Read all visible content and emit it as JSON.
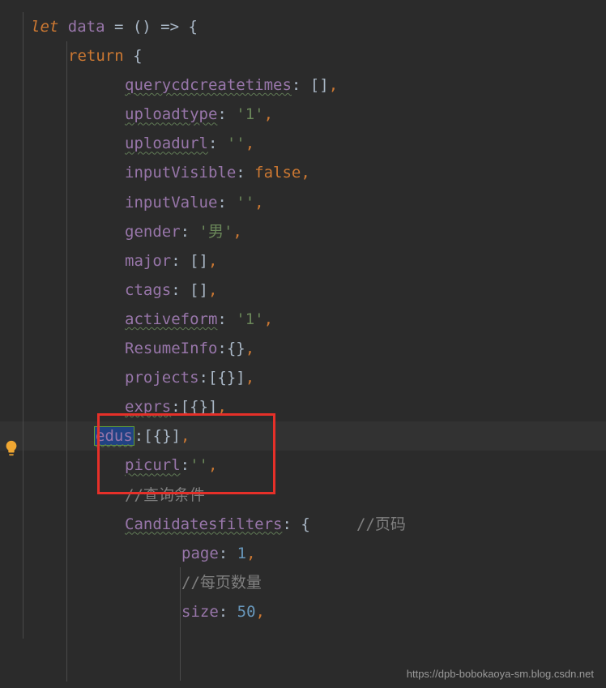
{
  "code": {
    "line1_let": "let",
    "line1_data": "data",
    "line1_rest": " = () => {",
    "line2_return": "return",
    "line2_brace": " {",
    "p_querycdcreatetimes": "querycdcreatetimes",
    "v_querycdcreatetimes": "[]",
    "p_uploadtype": "uploadtype",
    "v_uploadtype": "'1'",
    "p_uploadurl": "uploadurl",
    "v_uploadurl": "''",
    "p_inputVisible": "inputVisible",
    "v_inputVisible": "false",
    "p_inputValue": "inputValue",
    "v_inputValue": "''",
    "p_gender": "gender",
    "v_gender": "'男'",
    "p_major": "major",
    "v_major": "[]",
    "p_ctags": "ctags",
    "v_ctags": "[]",
    "p_activeform": "activeform",
    "v_activeform": "'1'",
    "p_ResumeInfo": "ResumeInfo",
    "v_ResumeInfo": "{}",
    "p_projects": "projects",
    "v_projects": "[{}]",
    "p_exprs": "exprs",
    "v_exprs": "[{}]",
    "p_edus": "edus",
    "v_edus": "[{}]",
    "p_picurl": "picurl",
    "v_picurl": "''",
    "comment_query": "//查询条件",
    "p_Candidatesfilters": "Candidatesfilters",
    "v_Candidatesfilters_open": "{",
    "comment_page": "//页码",
    "p_page": "page",
    "v_page": "1",
    "comment_size": "//每页数量",
    "p_size": "size",
    "v_size": "50"
  },
  "watermark": "https://dpb-bobokaoya-sm.blog.csdn.net"
}
